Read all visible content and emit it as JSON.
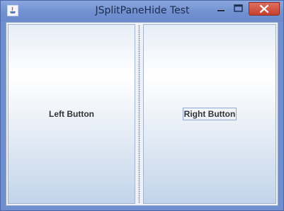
{
  "window": {
    "title": "JSplitPaneHide Test",
    "icons": {
      "app": "java-app-icon",
      "minimize": "minimize-icon",
      "maximize": "maximize-icon",
      "close": "close-icon"
    },
    "colors": {
      "titlebar": "#6f8fd0",
      "close_button": "#c8402d"
    }
  },
  "split_pane": {
    "left_button_label": "Left Button",
    "right_button_label": "Right Button",
    "divider_icon": "split-divider-grip"
  }
}
